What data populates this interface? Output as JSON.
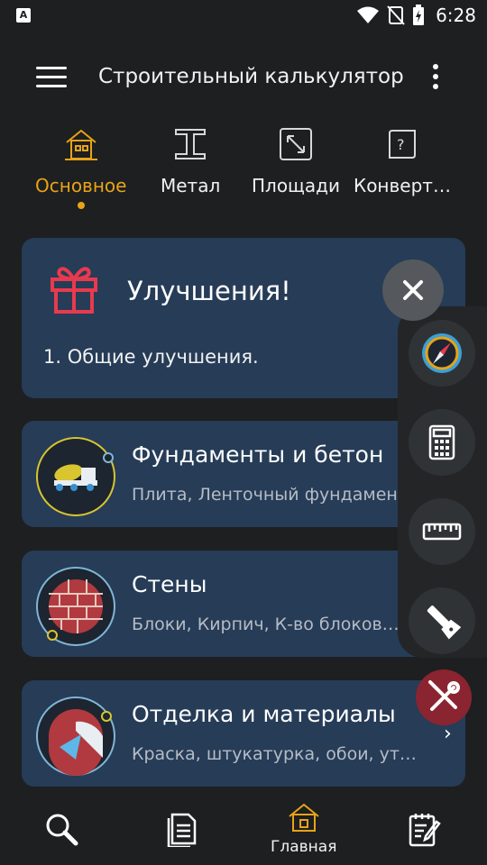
{
  "statusbar": {
    "time": "6:28",
    "app_badge": "A"
  },
  "appbar": {
    "title": "Строительный калькулятор"
  },
  "tabs": [
    {
      "label": "Основное",
      "icon": "house-icon",
      "active": true
    },
    {
      "label": "Метал",
      "icon": "i-beam-icon",
      "active": false
    },
    {
      "label": "Площади",
      "icon": "expand-arrows-icon",
      "active": false
    },
    {
      "label": "Конверт…",
      "icon": "convert-question-icon",
      "active": false
    }
  ],
  "promo": {
    "title": "Улучшения!",
    "text": "1. Общие улучшения.",
    "icon": "gift-icon"
  },
  "categories": [
    {
      "title": "Фундаменты и бетон",
      "subtitle": "Плита, Ленточный фундамен…",
      "icon": "concrete-mixer-icon"
    },
    {
      "title": "Стены",
      "subtitle": "Блоки, Кирпич, К-во блоков…",
      "icon": "brick-wall-icon"
    },
    {
      "title": "Отделка и материалы",
      "subtitle": "Краска, штукатурка, обои, ут…",
      "icon": "trowel-icon"
    }
  ],
  "fabs": [
    "compass-icon",
    "calculator-icon",
    "ruler-icon",
    "flashlight-icon",
    "tools-icon"
  ],
  "bottomnav": {
    "home_label": "Главная",
    "items": [
      "search-icon",
      "document-icon",
      "home-icon",
      "notepad-edit-icon"
    ]
  },
  "colors": {
    "accent": "#e8a317",
    "card": "#263c57",
    "background": "#1d1f21",
    "tools_fab": "#8a2430"
  }
}
